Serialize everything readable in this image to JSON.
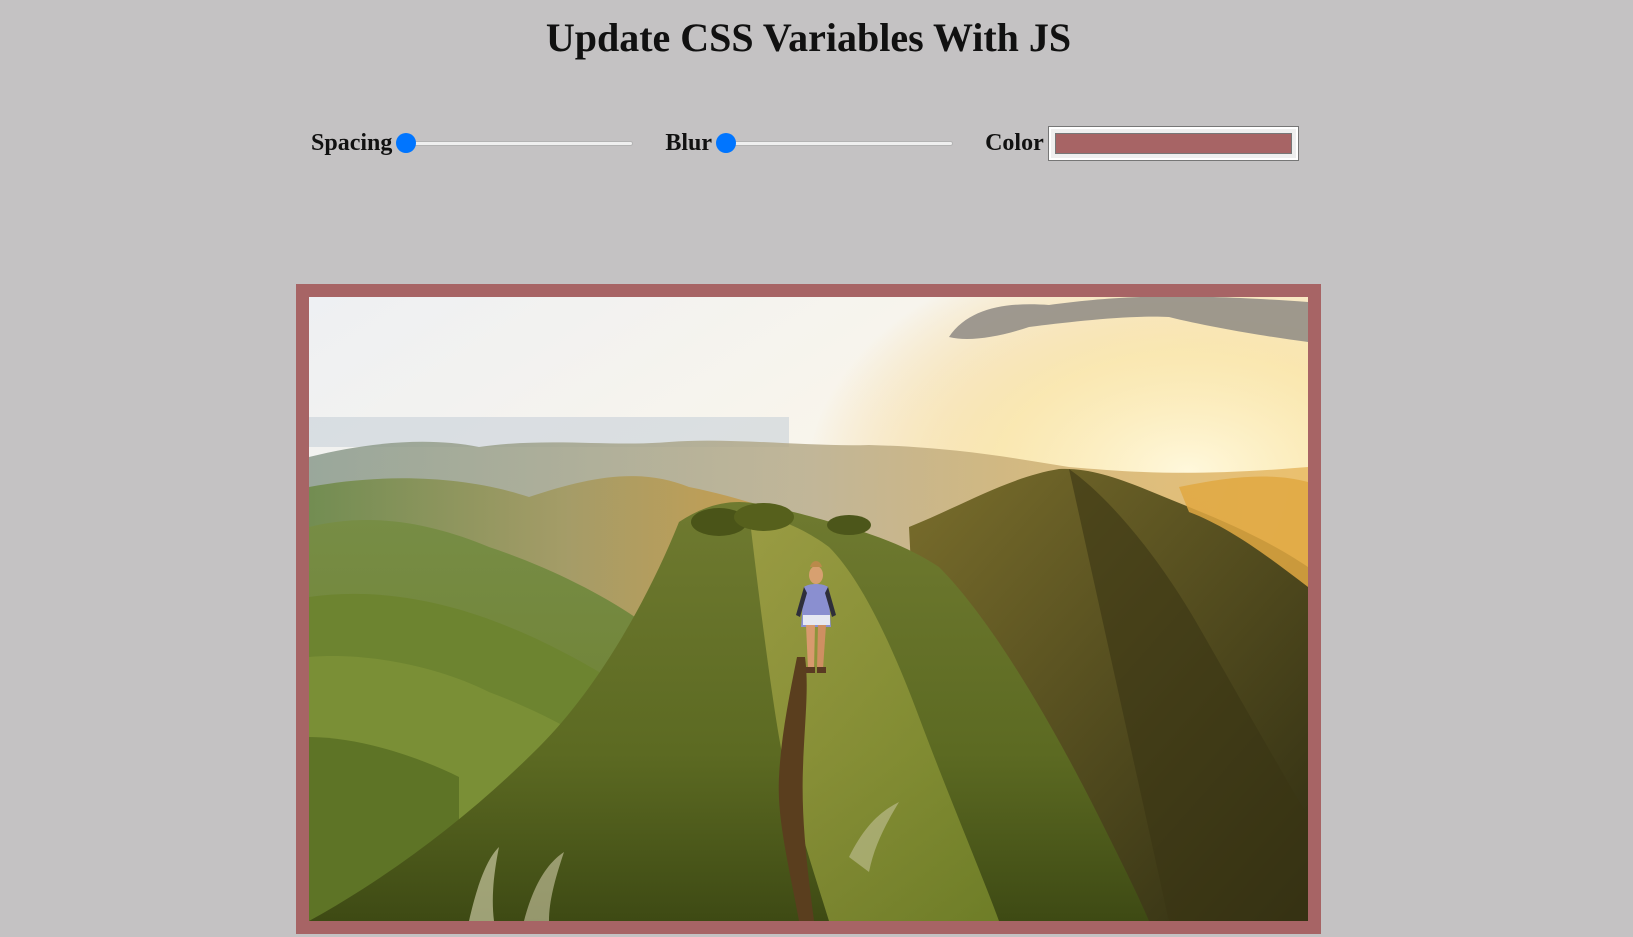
{
  "page": {
    "title": "Update CSS Variables With JS"
  },
  "controls": {
    "spacing": {
      "label": "Spacing",
      "value": 0,
      "min": 0,
      "max": 200
    },
    "blur": {
      "label": "Blur",
      "value": 0,
      "min": 0,
      "max": 25
    },
    "color": {
      "label": "Color",
      "value": "#a76465"
    }
  },
  "colors": {
    "background": "#c4c2c3",
    "base": "#a76465",
    "slider_accent": "#0075ff"
  },
  "image": {
    "subject": "hiker-on-mountain-ridge"
  }
}
